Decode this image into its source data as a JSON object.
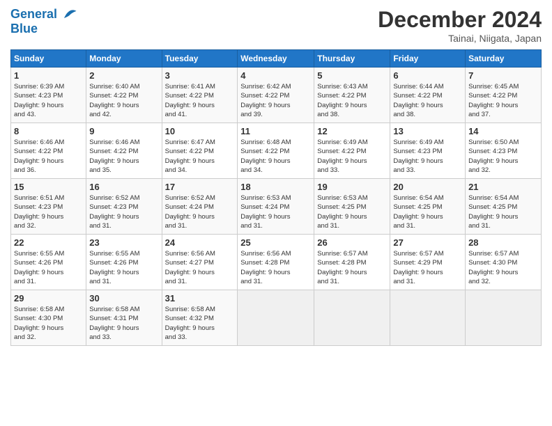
{
  "header": {
    "logo_line1": "General",
    "logo_line2": "Blue",
    "month": "December 2024",
    "location": "Tainai, Niigata, Japan"
  },
  "days_of_week": [
    "Sunday",
    "Monday",
    "Tuesday",
    "Wednesday",
    "Thursday",
    "Friday",
    "Saturday"
  ],
  "weeks": [
    [
      {
        "day": 1,
        "rise": "6:39 AM",
        "set": "4:23 PM",
        "hours": "9 hours",
        "mins": "43 minutes"
      },
      {
        "day": 2,
        "rise": "6:40 AM",
        "set": "4:22 PM",
        "hours": "9 hours",
        "mins": "42 minutes"
      },
      {
        "day": 3,
        "rise": "6:41 AM",
        "set": "4:22 PM",
        "hours": "9 hours",
        "mins": "41 minutes"
      },
      {
        "day": 4,
        "rise": "6:42 AM",
        "set": "4:22 PM",
        "hours": "9 hours",
        "mins": "39 minutes"
      },
      {
        "day": 5,
        "rise": "6:43 AM",
        "set": "4:22 PM",
        "hours": "9 hours",
        "mins": "38 minutes"
      },
      {
        "day": 6,
        "rise": "6:44 AM",
        "set": "4:22 PM",
        "hours": "9 hours",
        "mins": "38 minutes"
      },
      {
        "day": 7,
        "rise": "6:45 AM",
        "set": "4:22 PM",
        "hours": "9 hours",
        "mins": "37 minutes"
      }
    ],
    [
      {
        "day": 8,
        "rise": "6:46 AM",
        "set": "4:22 PM",
        "hours": "9 hours",
        "mins": "36 minutes"
      },
      {
        "day": 9,
        "rise": "6:46 AM",
        "set": "4:22 PM",
        "hours": "9 hours",
        "mins": "35 minutes"
      },
      {
        "day": 10,
        "rise": "6:47 AM",
        "set": "4:22 PM",
        "hours": "9 hours",
        "mins": "34 minutes"
      },
      {
        "day": 11,
        "rise": "6:48 AM",
        "set": "4:22 PM",
        "hours": "9 hours",
        "mins": "34 minutes"
      },
      {
        "day": 12,
        "rise": "6:49 AM",
        "set": "4:22 PM",
        "hours": "9 hours",
        "mins": "33 minutes"
      },
      {
        "day": 13,
        "rise": "6:49 AM",
        "set": "4:23 PM",
        "hours": "9 hours",
        "mins": "33 minutes"
      },
      {
        "day": 14,
        "rise": "6:50 AM",
        "set": "4:23 PM",
        "hours": "9 hours",
        "mins": "32 minutes"
      }
    ],
    [
      {
        "day": 15,
        "rise": "6:51 AM",
        "set": "4:23 PM",
        "hours": "9 hours",
        "mins": "32 minutes"
      },
      {
        "day": 16,
        "rise": "6:52 AM",
        "set": "4:23 PM",
        "hours": "9 hours",
        "mins": "31 minutes"
      },
      {
        "day": 17,
        "rise": "6:52 AM",
        "set": "4:24 PM",
        "hours": "9 hours",
        "mins": "31 minutes"
      },
      {
        "day": 18,
        "rise": "6:53 AM",
        "set": "4:24 PM",
        "hours": "9 hours",
        "mins": "31 minutes"
      },
      {
        "day": 19,
        "rise": "6:53 AM",
        "set": "4:25 PM",
        "hours": "9 hours",
        "mins": "31 minutes"
      },
      {
        "day": 20,
        "rise": "6:54 AM",
        "set": "4:25 PM",
        "hours": "9 hours",
        "mins": "31 minutes"
      },
      {
        "day": 21,
        "rise": "6:54 AM",
        "set": "4:25 PM",
        "hours": "9 hours",
        "mins": "31 minutes"
      }
    ],
    [
      {
        "day": 22,
        "rise": "6:55 AM",
        "set": "4:26 PM",
        "hours": "9 hours",
        "mins": "31 minutes"
      },
      {
        "day": 23,
        "rise": "6:55 AM",
        "set": "4:26 PM",
        "hours": "9 hours",
        "mins": "31 minutes"
      },
      {
        "day": 24,
        "rise": "6:56 AM",
        "set": "4:27 PM",
        "hours": "9 hours",
        "mins": "31 minutes"
      },
      {
        "day": 25,
        "rise": "6:56 AM",
        "set": "4:28 PM",
        "hours": "9 hours",
        "mins": "31 minutes"
      },
      {
        "day": 26,
        "rise": "6:57 AM",
        "set": "4:28 PM",
        "hours": "9 hours",
        "mins": "31 minutes"
      },
      {
        "day": 27,
        "rise": "6:57 AM",
        "set": "4:29 PM",
        "hours": "9 hours",
        "mins": "31 minutes"
      },
      {
        "day": 28,
        "rise": "6:57 AM",
        "set": "4:30 PM",
        "hours": "9 hours",
        "mins": "32 minutes"
      }
    ],
    [
      {
        "day": 29,
        "rise": "6:58 AM",
        "set": "4:30 PM",
        "hours": "9 hours",
        "mins": "32 minutes"
      },
      {
        "day": 30,
        "rise": "6:58 AM",
        "set": "4:31 PM",
        "hours": "9 hours",
        "mins": "33 minutes"
      },
      {
        "day": 31,
        "rise": "6:58 AM",
        "set": "4:32 PM",
        "hours": "9 hours",
        "mins": "33 minutes"
      },
      null,
      null,
      null,
      null
    ]
  ],
  "labels": {
    "sunrise": "Sunrise:",
    "sunset": "Sunset:",
    "daylight": "Daylight:"
  }
}
